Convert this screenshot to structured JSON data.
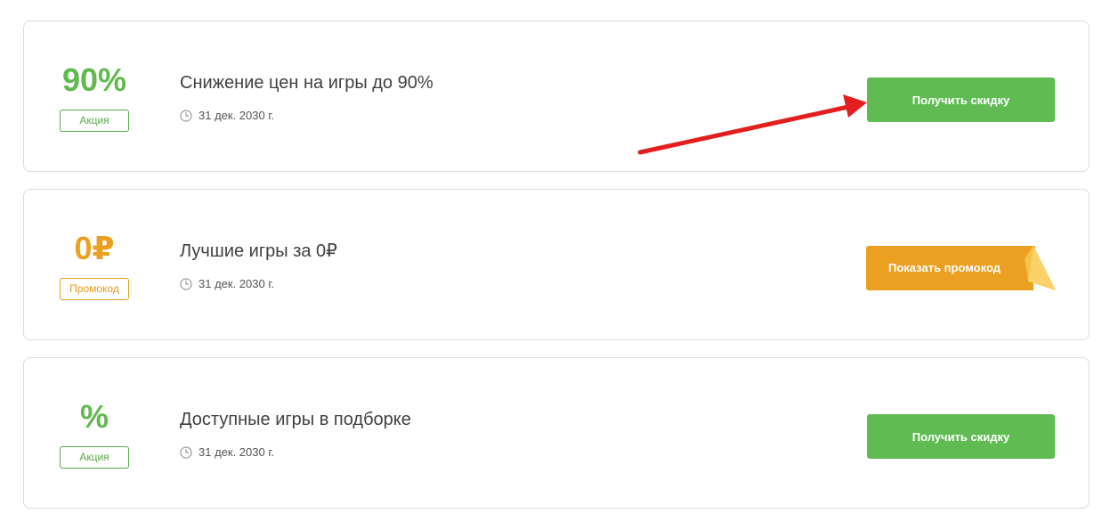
{
  "offers": [
    {
      "value": "90%",
      "badge": "Акция",
      "title": "Снижение цен на игры до 90%",
      "date": "31 дек. 2030 г.",
      "button": "Получить скидку",
      "color": "#62b94f"
    },
    {
      "value": "0₽",
      "badge": "Промокод",
      "title": "Лучшие игры за 0₽",
      "date": "31 дек. 2030 г.",
      "button": "Показать промокод",
      "color": "#eba021"
    },
    {
      "value": "%",
      "badge": "Акция",
      "title": "Доступные игры в подборке",
      "date": "31 дек. 2030 г.",
      "button": "Получить скидку",
      "color": "#62b94f"
    }
  ],
  "colors": {
    "accent_green": "#5fbb52",
    "accent_orange": "#eba021",
    "annotation_arrow": "#e31e1e"
  },
  "icons": {
    "date": "clock-icon",
    "annotation": "red-arrow-pointer"
  }
}
